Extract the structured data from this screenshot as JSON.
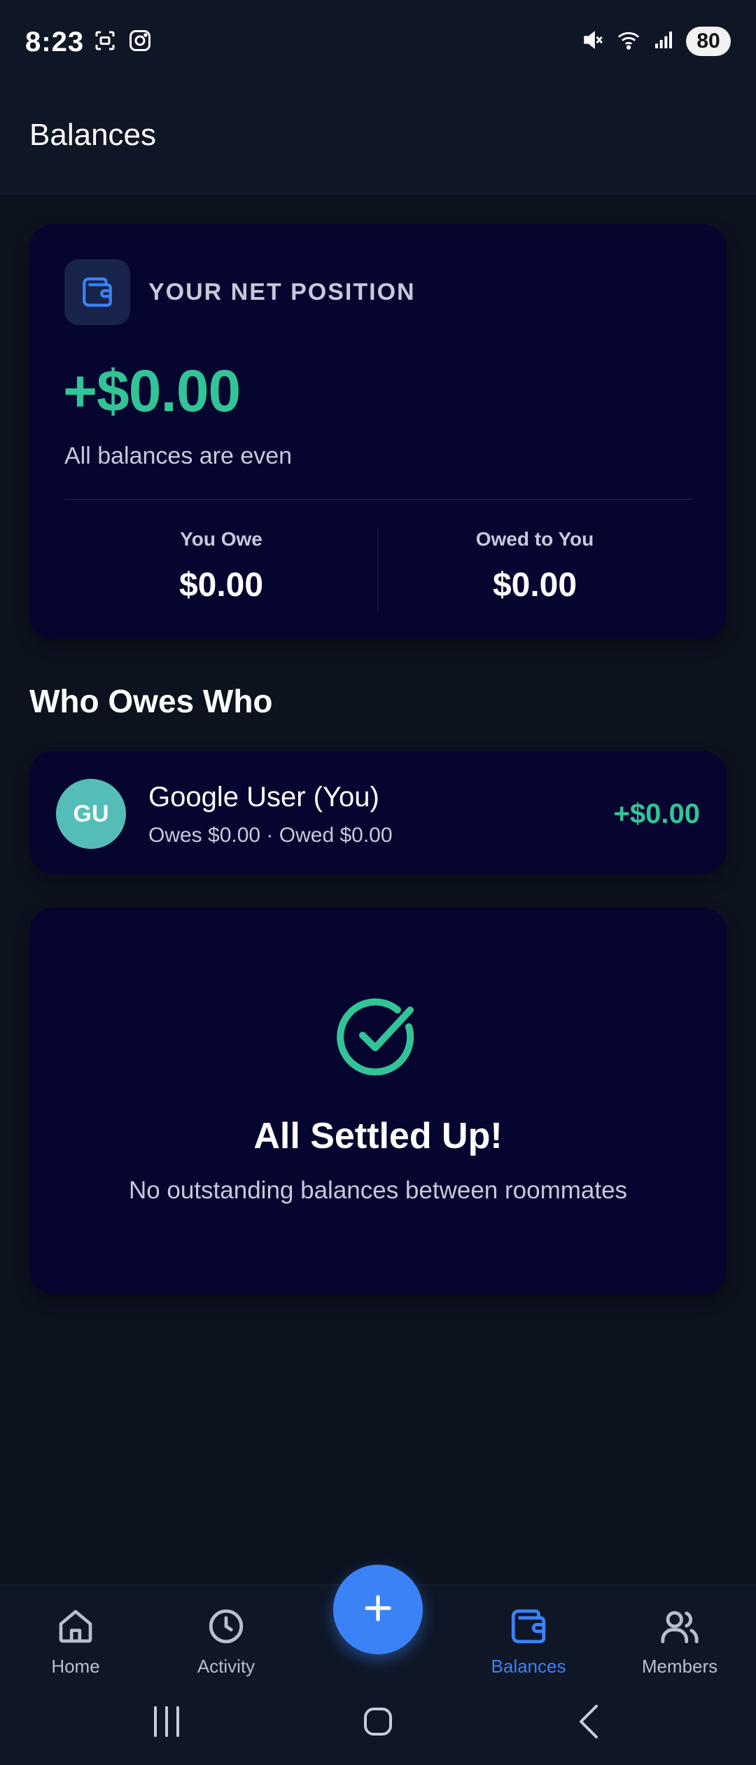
{
  "status_bar": {
    "time": "8:23",
    "battery": "80",
    "icons": [
      "screenshot-icon",
      "instagram-icon",
      "mute-icon",
      "wifi-icon",
      "signal-icon",
      "battery-icon"
    ]
  },
  "header": {
    "title": "Balances"
  },
  "net_position": {
    "label": "YOUR NET POSITION",
    "amount": "+$0.00",
    "subtitle": "All balances are even",
    "you_owe_label": "You Owe",
    "you_owe_value": "$0.00",
    "owed_to_you_label": "Owed to You",
    "owed_to_you_value": "$0.00"
  },
  "who_owes": {
    "title": "Who Owes Who",
    "members": [
      {
        "initials": "GU",
        "name": "Google User (You)",
        "meta": "Owes $0.00 · Owed $0.00",
        "amount": "+$0.00"
      }
    ]
  },
  "settled": {
    "title": "All Settled Up!",
    "subtitle": "No outstanding balances between roommates"
  },
  "bottom_nav": {
    "items": [
      {
        "label": "Home",
        "icon": "home-icon"
      },
      {
        "label": "Activity",
        "icon": "clock-icon"
      },
      {
        "label": "Balances",
        "icon": "wallet-icon",
        "active": true
      },
      {
        "label": "Members",
        "icon": "members-icon"
      }
    ],
    "fab_icon": "plus-icon"
  },
  "colors": {
    "background": "#0c131f",
    "card": "#05052f",
    "positive": "#32c496",
    "accent": "#3b82f6",
    "avatar": "#55bdb7"
  }
}
